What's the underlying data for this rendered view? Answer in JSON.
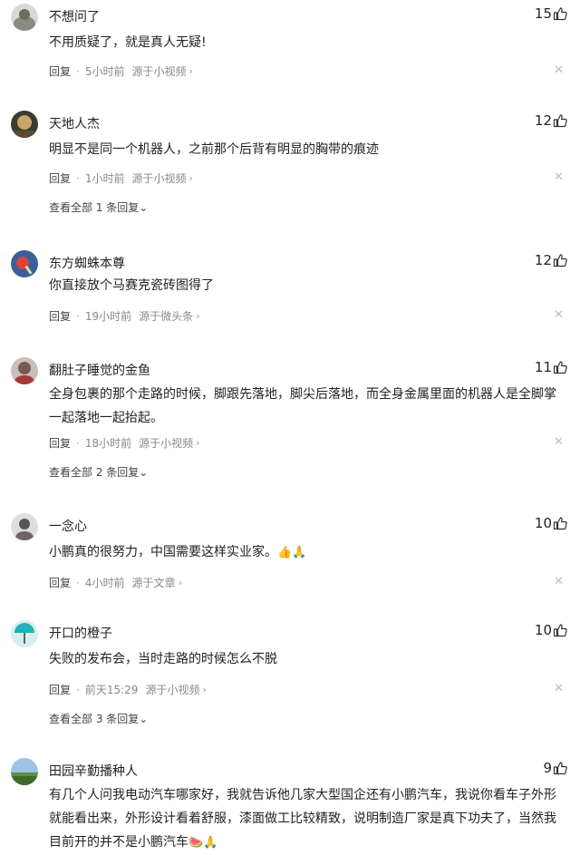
{
  "comments": [
    {
      "user": "不想问了",
      "likes": "15",
      "text": "不用质疑了，就是真人无疑!",
      "reply": "回复",
      "time": "5小时前",
      "source": "源于小视频",
      "view_all": ""
    },
    {
      "user": "天地人杰",
      "likes": "12",
      "text": "明显不是同一个机器人，之前那个后背有明显的胸带的痕迹",
      "reply": "回复",
      "time": "1小时前",
      "source": "源于小视频",
      "view_all": "查看全部 1 条回复"
    },
    {
      "user": "东方蜘蛛本尊",
      "likes": "12",
      "text": "你直接放个马赛克瓷砖图得了",
      "reply": "回复",
      "time": "19小时前",
      "source": "源于微头条",
      "view_all": ""
    },
    {
      "user": "翻肚子睡觉的金鱼",
      "likes": "11",
      "text": "全身包裹的那个走路的时候，脚跟先落地，脚尖后落地，而全身金属里面的机器人是全脚掌一起落地一起抬起。",
      "reply": "回复",
      "time": "18小时前",
      "source": "源于小视频",
      "view_all": "查看全部 2 条回复"
    },
    {
      "user": "一念心",
      "likes": "10",
      "text": "小鹏真的很努力，中国需要这样实业家。",
      "emoji": "👍🙏",
      "reply": "回复",
      "time": "4小时前",
      "source": "源于文章",
      "view_all": ""
    },
    {
      "user": "开口的橙子",
      "likes": "10",
      "text": "失败的发布会，当时走路的时候怎么不脱",
      "reply": "回复",
      "time": "前天15:29",
      "source": "源于小视频",
      "view_all": "查看全部 3 条回复"
    },
    {
      "user": "田园辛勤播种人",
      "likes": "9",
      "text": "有几个人问我电动汽车哪家好，我就告诉他几家大型国企还有小鹏汽车，我说你看车子外形就能看出来，外形设计看着舒服，漆面做工比较精致，说明制造厂家是真下功夫了，当然我目前开的并不是小鹏汽车",
      "emoji": "🍉🙏"
    }
  ],
  "icons": {
    "like": "thumbs-up-icon",
    "close": "close-icon",
    "chevron": "chevron-right-icon",
    "expand": "chevron-down-icon"
  },
  "colors": {
    "text": "#222222",
    "meta": "#888888",
    "background": "#ffffff"
  }
}
